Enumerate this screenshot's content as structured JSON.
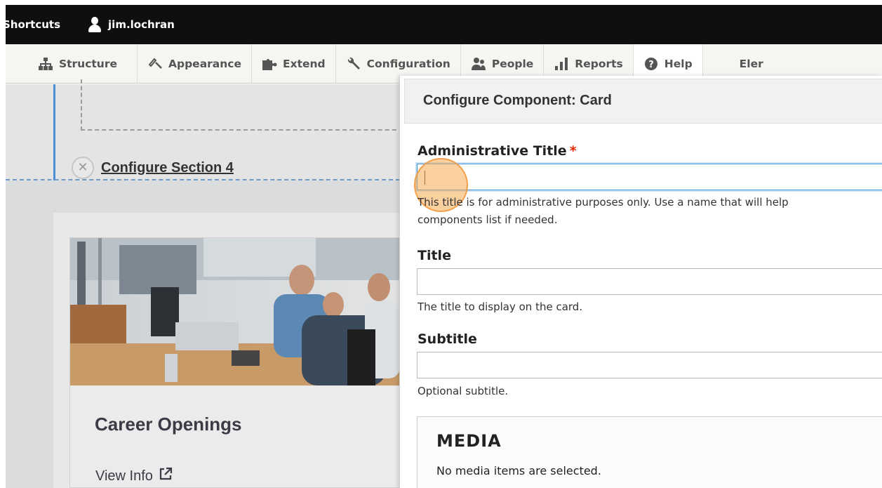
{
  "toolbar": {
    "shortcuts": "Shortcuts",
    "user": "jim.lochran"
  },
  "tray": {
    "items": [
      {
        "label": "Structure",
        "icon": "sitemap-icon"
      },
      {
        "label": "Appearance",
        "icon": "paint-brush-icon"
      },
      {
        "label": "Extend",
        "icon": "puzzle-icon"
      },
      {
        "label": "Configuration",
        "icon": "wrench-icon"
      },
      {
        "label": "People",
        "icon": "people-icon"
      },
      {
        "label": "Reports",
        "icon": "bar-chart-icon"
      },
      {
        "label": "Help",
        "icon": "help-icon"
      },
      {
        "label": "Eler",
        "icon": ""
      }
    ]
  },
  "layout": {
    "configure_section": "Configure Section 4",
    "remove_symbol": "✕"
  },
  "card": {
    "title": "Career Openings",
    "link": "View Info"
  },
  "dialog": {
    "title": "Configure Component: Card",
    "admin_title_label": "Administrative Title",
    "required_mark": "*",
    "admin_title_value": "",
    "admin_title_desc_line1": "This title is for administrative purposes only. Use a name that will help",
    "admin_title_desc_line2": "components list if needed.",
    "title_label": "Title",
    "title_value": "",
    "title_desc": "The title to display on the card.",
    "subtitle_label": "Subtitle",
    "subtitle_value": "",
    "subtitle_desc": "Optional subtitle.",
    "media_legend": "MEDIA",
    "media_empty": "No media items are selected."
  },
  "colors": {
    "toolbar_bg": "#0f0f0f",
    "tray_bg": "#f5f5f2",
    "focus_border": "#3f92d8",
    "required": "#e62600",
    "section_accent": "#4c8ed6",
    "click_marker": "#f8aa50"
  }
}
